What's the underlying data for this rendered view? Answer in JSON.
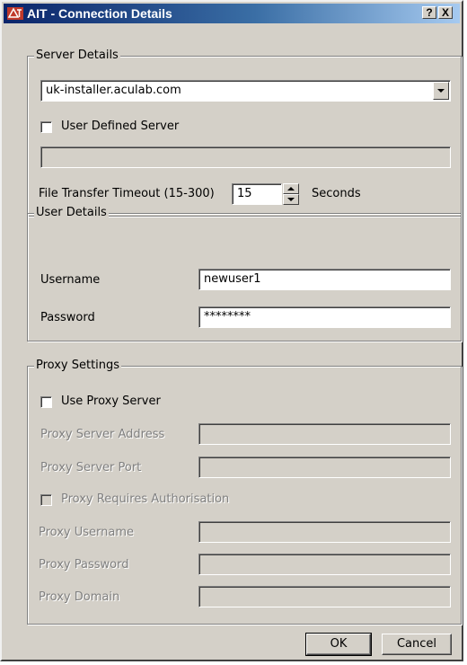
{
  "window": {
    "title": "AIT - Connection Details",
    "help_button": "?",
    "close_button": "X"
  },
  "server_details": {
    "legend": "Server Details",
    "server_select": "uk-installer.aculab.com",
    "user_defined_label": "User Defined Server",
    "user_defined_checked": false,
    "user_defined_value": "",
    "timeout_label": "File Transfer Timeout (15-300)",
    "timeout_value": "15",
    "timeout_unit": "Seconds"
  },
  "user_details": {
    "legend": "User Details",
    "username_label": "Username",
    "username_value": "newuser1",
    "password_label": "Password",
    "password_value": "********"
  },
  "proxy_settings": {
    "legend": "Proxy Settings",
    "use_proxy_label": "Use Proxy Server",
    "use_proxy_checked": false,
    "address_label": "Proxy Server Address",
    "address_value": "",
    "port_label": "Proxy Server Port",
    "port_value": "",
    "requires_auth_label": "Proxy Requires Authorisation",
    "requires_auth_checked": false,
    "username_label": "Proxy Username",
    "username_value": "",
    "password_label": "Proxy Password",
    "password_value": "",
    "domain_label": "Proxy Domain",
    "domain_value": ""
  },
  "buttons": {
    "ok": "OK",
    "cancel": "Cancel"
  },
  "colors": {
    "dialog_face": "#d4d0c8",
    "title_bar_start": "#0a246a",
    "title_bar_end": "#a6caf0",
    "disabled_text": "#808080"
  }
}
